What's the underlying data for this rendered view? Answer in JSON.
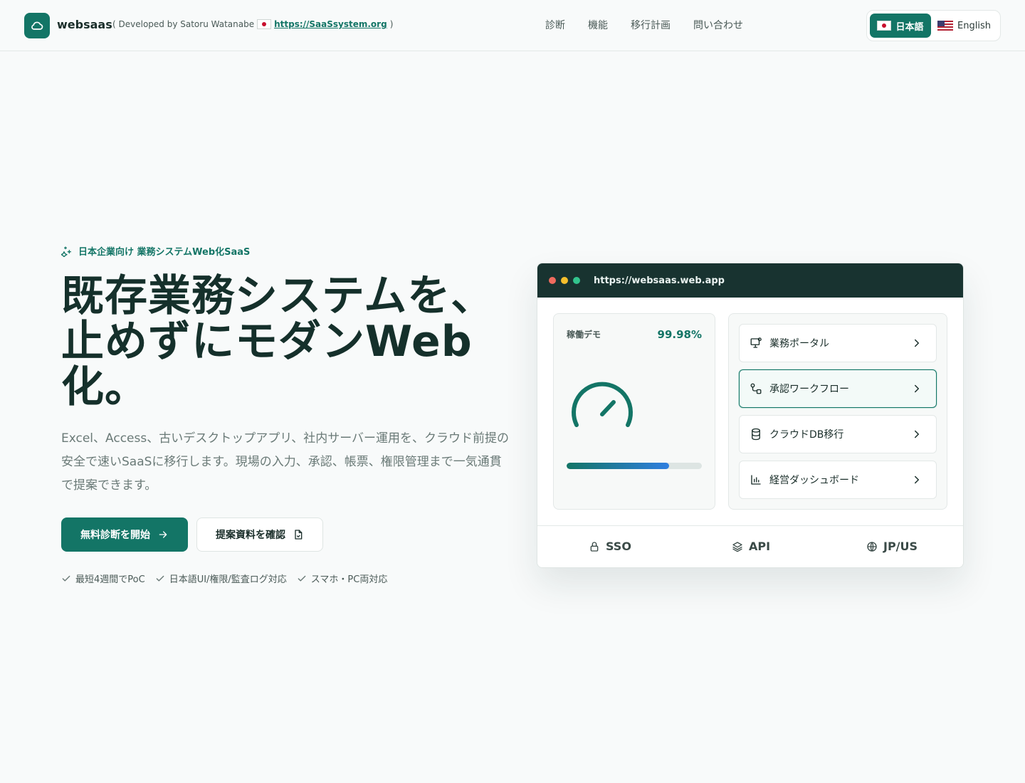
{
  "header": {
    "brand": "websaas",
    "developed_by": "( Developed by Satoru Watanabe",
    "site_link": "https://SaaSsystem.org",
    "closing_paren": ")",
    "nav": [
      "診断",
      "機能",
      "移行計画",
      "問い合わせ"
    ],
    "lang_ja": "日本語",
    "lang_en": "English"
  },
  "hero": {
    "eyebrow": "日本企業向け 業務システムWeb化SaaS",
    "title": "既存業務システムを、止めずにモダンWeb化。",
    "description": "Excel、Access、古いデスクトップアプリ、社内サーバー運用を、クラウド前提の安全で速いSaaSに移行します。現場の入力、承認、帳票、権限管理まで一気通貫で提案できます。",
    "primary_button": "無料診断を開始",
    "secondary_button": "提案資料を確認",
    "checks": [
      "最短4週間でPoC",
      "日本語UI/権限/監査ログ対応",
      "スマホ・PC両対応"
    ]
  },
  "mockup": {
    "url": "https://websaas.web.app",
    "uptime_label": "稼働デモ",
    "uptime_value": "99.98%",
    "progress_fraction": 0.76,
    "menu": [
      {
        "label": "業務ポータル",
        "icon": "monitor-icon"
      },
      {
        "label": "承認ワークフロー",
        "icon": "workflow-icon"
      },
      {
        "label": "クラウドDB移行",
        "icon": "database-icon"
      },
      {
        "label": "経営ダッシュボード",
        "icon": "bar-chart-icon"
      }
    ],
    "features": [
      "SSO",
      "API",
      "JP/US"
    ]
  },
  "colors": {
    "accent": "#137566",
    "mock_bar": "#183330",
    "dot_red": "#ef6b5e",
    "dot_yellow": "#f5bf2c",
    "dot_green": "#32c48d"
  }
}
